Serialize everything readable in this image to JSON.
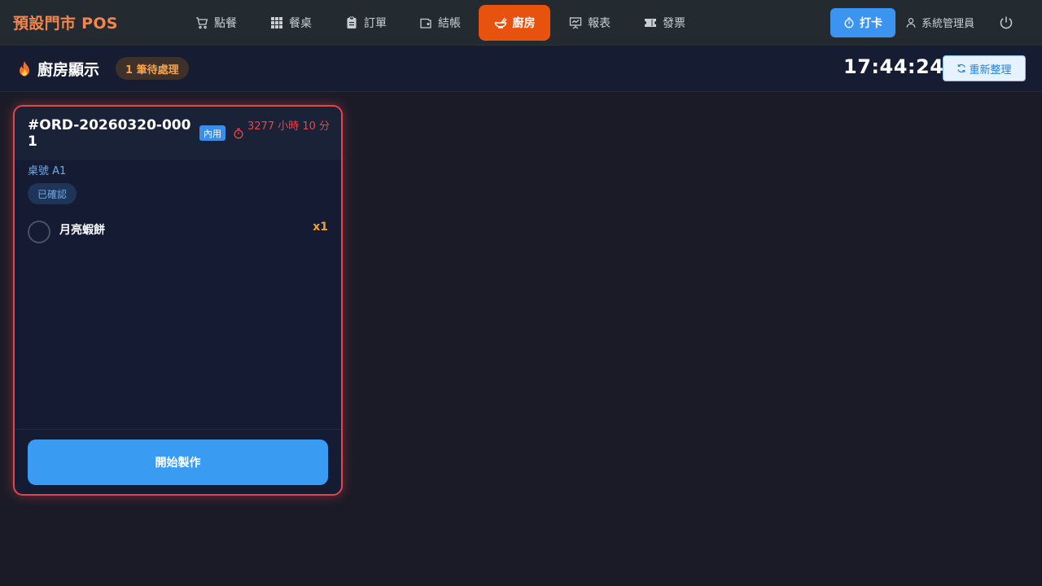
{
  "app": {
    "brand": "預設門市 POS"
  },
  "nav": [
    {
      "label": "點餐",
      "icon": "cart-icon",
      "active": false
    },
    {
      "label": "餐桌",
      "icon": "grid-icon",
      "active": false
    },
    {
      "label": "訂單",
      "icon": "clipboard-icon",
      "active": false
    },
    {
      "label": "結帳",
      "icon": "wallet-icon",
      "active": false
    },
    {
      "label": "廚房",
      "icon": "bowl-icon",
      "active": true
    },
    {
      "label": "報表",
      "icon": "presentation-icon",
      "active": false
    },
    {
      "label": "發票",
      "icon": "ticket-icon",
      "active": false
    }
  ],
  "header_right": {
    "punch_label": "打卡",
    "user_name": "系統管理員"
  },
  "kitchen": {
    "title": "廚房顯示",
    "pending_badge": "1 筆待處理",
    "clock": "17:44:24",
    "refresh_label": "重新整理"
  },
  "orders": [
    {
      "order_no": "#ORD-20260320-0001",
      "type_tag": "內用",
      "elapsed": "3277 小時 10 分",
      "table": "桌號 A1",
      "status": "已確認",
      "items": [
        {
          "name": "月亮蝦餅",
          "qty": "x1"
        }
      ],
      "action_label": "開始製作"
    }
  ],
  "colors": {
    "brand": "#f5854e",
    "active_nav": "#e8520f",
    "primary": "#3b95f0",
    "alert": "#e0464a",
    "qty": "#f5a024"
  }
}
